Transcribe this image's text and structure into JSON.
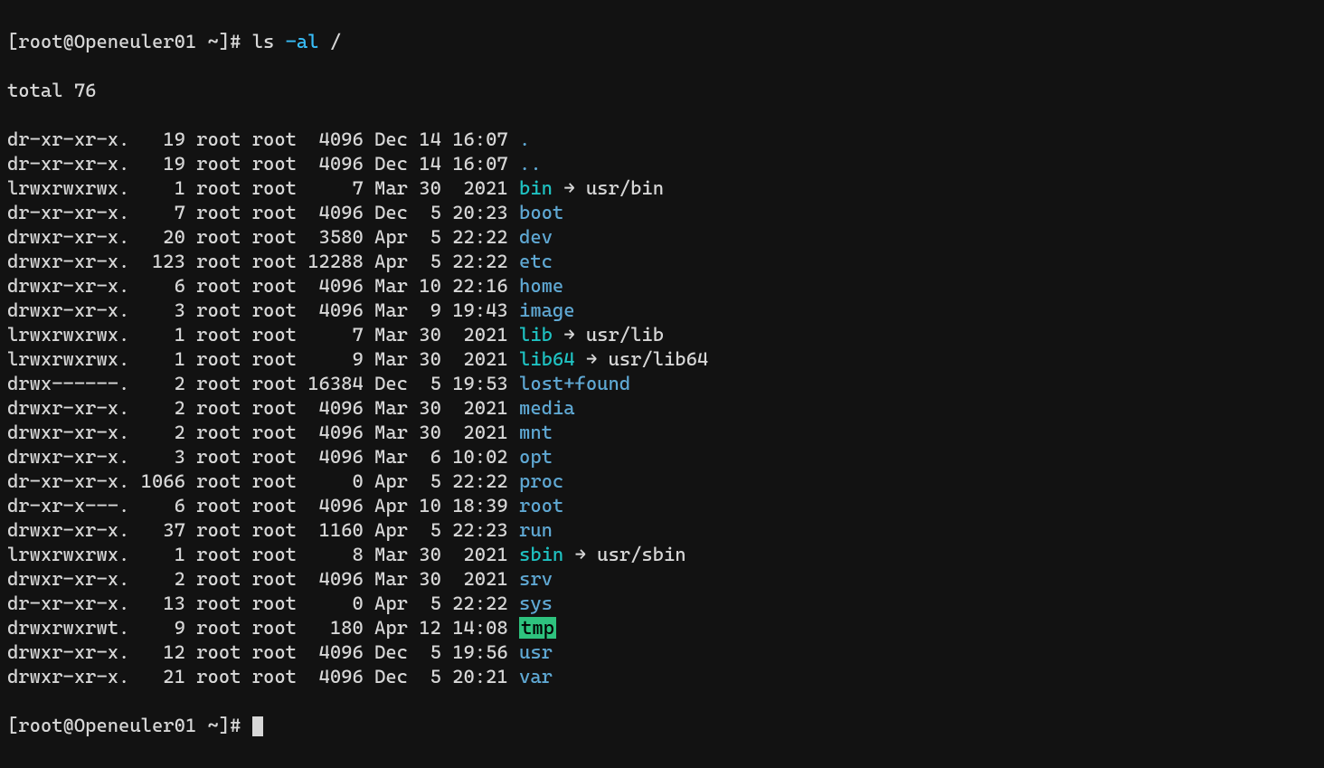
{
  "prompt": {
    "full": "[root@Openeuler01 ~]# ",
    "cmd": "ls ",
    "flag": "-al",
    "arg": " /"
  },
  "total_line": "total 76",
  "entries": [
    {
      "perm": "dr-xr-xr-x.",
      "links": "19",
      "owner": "root",
      "group": "root",
      "size": "4096",
      "month": "Dec",
      "day": "14",
      "time": "16:07",
      "name": ".",
      "type": "dir"
    },
    {
      "perm": "dr-xr-xr-x.",
      "links": "19",
      "owner": "root",
      "group": "root",
      "size": "4096",
      "month": "Dec",
      "day": "14",
      "time": "16:07",
      "name": "..",
      "type": "dir"
    },
    {
      "perm": "lrwxrwxrwx.",
      "links": "1",
      "owner": "root",
      "group": "root",
      "size": "7",
      "month": "Mar",
      "day": "30",
      "time": "2021",
      "name": "bin",
      "type": "symlink",
      "target": "usr/bin"
    },
    {
      "perm": "dr-xr-xr-x.",
      "links": "7",
      "owner": "root",
      "group": "root",
      "size": "4096",
      "month": "Dec",
      "day": "5",
      "time": "20:23",
      "name": "boot",
      "type": "dir"
    },
    {
      "perm": "drwxr-xr-x.",
      "links": "20",
      "owner": "root",
      "group": "root",
      "size": "3580",
      "month": "Apr",
      "day": "5",
      "time": "22:22",
      "name": "dev",
      "type": "dir"
    },
    {
      "perm": "drwxr-xr-x.",
      "links": "123",
      "owner": "root",
      "group": "root",
      "size": "12288",
      "month": "Apr",
      "day": "5",
      "time": "22:22",
      "name": "etc",
      "type": "dir"
    },
    {
      "perm": "drwxr-xr-x.",
      "links": "6",
      "owner": "root",
      "group": "root",
      "size": "4096",
      "month": "Mar",
      "day": "10",
      "time": "22:16",
      "name": "home",
      "type": "dir"
    },
    {
      "perm": "drwxr-xr-x.",
      "links": "3",
      "owner": "root",
      "group": "root",
      "size": "4096",
      "month": "Mar",
      "day": "9",
      "time": "19:43",
      "name": "image",
      "type": "dir"
    },
    {
      "perm": "lrwxrwxrwx.",
      "links": "1",
      "owner": "root",
      "group": "root",
      "size": "7",
      "month": "Mar",
      "day": "30",
      "time": "2021",
      "name": "lib",
      "type": "symlink",
      "target": "usr/lib"
    },
    {
      "perm": "lrwxrwxrwx.",
      "links": "1",
      "owner": "root",
      "group": "root",
      "size": "9",
      "month": "Mar",
      "day": "30",
      "time": "2021",
      "name": "lib64",
      "type": "symlink",
      "target": "usr/lib64"
    },
    {
      "perm": "drwx------.",
      "links": "2",
      "owner": "root",
      "group": "root",
      "size": "16384",
      "month": "Dec",
      "day": "5",
      "time": "19:53",
      "name": "lost+found",
      "type": "dir"
    },
    {
      "perm": "drwxr-xr-x.",
      "links": "2",
      "owner": "root",
      "group": "root",
      "size": "4096",
      "month": "Mar",
      "day": "30",
      "time": "2021",
      "name": "media",
      "type": "dir"
    },
    {
      "perm": "drwxr-xr-x.",
      "links": "2",
      "owner": "root",
      "group": "root",
      "size": "4096",
      "month": "Mar",
      "day": "30",
      "time": "2021",
      "name": "mnt",
      "type": "dir"
    },
    {
      "perm": "drwxr-xr-x.",
      "links": "3",
      "owner": "root",
      "group": "root",
      "size": "4096",
      "month": "Mar",
      "day": "6",
      "time": "10:02",
      "name": "opt",
      "type": "dir"
    },
    {
      "perm": "dr-xr-xr-x.",
      "links": "1066",
      "owner": "root",
      "group": "root",
      "size": "0",
      "month": "Apr",
      "day": "5",
      "time": "22:22",
      "name": "proc",
      "type": "dir"
    },
    {
      "perm": "dr-xr-x---.",
      "links": "6",
      "owner": "root",
      "group": "root",
      "size": "4096",
      "month": "Apr",
      "day": "10",
      "time": "18:39",
      "name": "root",
      "type": "dir"
    },
    {
      "perm": "drwxr-xr-x.",
      "links": "37",
      "owner": "root",
      "group": "root",
      "size": "1160",
      "month": "Apr",
      "day": "5",
      "time": "22:23",
      "name": "run",
      "type": "dir"
    },
    {
      "perm": "lrwxrwxrwx.",
      "links": "1",
      "owner": "root",
      "group": "root",
      "size": "8",
      "month": "Mar",
      "day": "30",
      "time": "2021",
      "name": "sbin",
      "type": "symlink",
      "target": "usr/sbin"
    },
    {
      "perm": "drwxr-xr-x.",
      "links": "2",
      "owner": "root",
      "group": "root",
      "size": "4096",
      "month": "Mar",
      "day": "30",
      "time": "2021",
      "name": "srv",
      "type": "dir"
    },
    {
      "perm": "dr-xr-xr-x.",
      "links": "13",
      "owner": "root",
      "group": "root",
      "size": "0",
      "month": "Apr",
      "day": "5",
      "time": "22:22",
      "name": "sys",
      "type": "dir"
    },
    {
      "perm": "drwxrwxrwt.",
      "links": "9",
      "owner": "root",
      "group": "root",
      "size": "180",
      "month": "Apr",
      "day": "12",
      "time": "14:08",
      "name": "tmp",
      "type": "sticky"
    },
    {
      "perm": "drwxr-xr-x.",
      "links": "12",
      "owner": "root",
      "group": "root",
      "size": "4096",
      "month": "Dec",
      "day": "5",
      "time": "19:56",
      "name": "usr",
      "type": "dir"
    },
    {
      "perm": "drwxr-xr-x.",
      "links": "21",
      "owner": "root",
      "group": "root",
      "size": "4096",
      "month": "Dec",
      "day": "5",
      "time": "20:21",
      "name": "var",
      "type": "dir"
    }
  ],
  "prompt2": "[root@Openeuler01 ~]# "
}
